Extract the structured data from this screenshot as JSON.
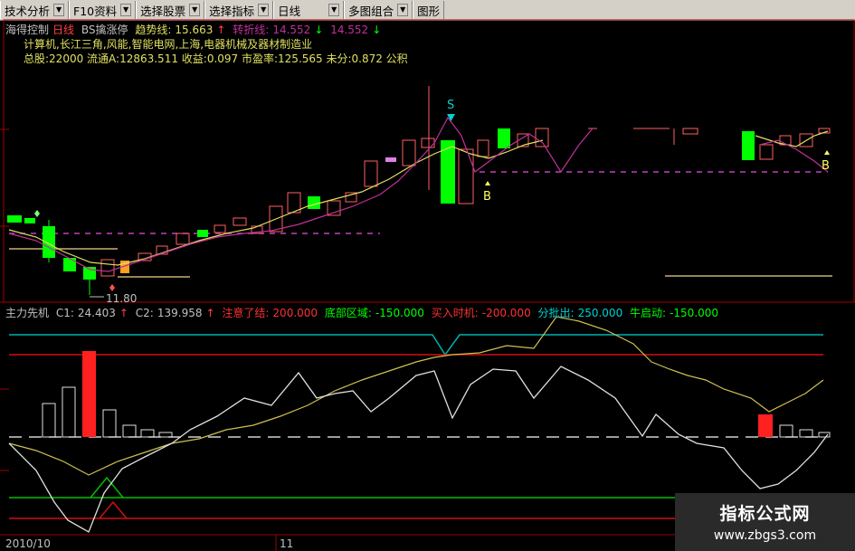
{
  "toolbar": {
    "items": [
      {
        "label": "技术分析"
      },
      {
        "label": "F10资料"
      },
      {
        "label": "选择股票"
      },
      {
        "label": "选择指标"
      },
      {
        "label": "日线"
      },
      {
        "label": "多图组合"
      },
      {
        "label": "图形"
      }
    ]
  },
  "main_header": {
    "stock_name": "海得控制",
    "period": "日线",
    "indicator": "BS擒涨停",
    "trend_label": "趋势线:",
    "trend_value": "15.663",
    "turn_label": "转折线:",
    "turn_value": "14.552",
    "turn_value2": "14.552"
  },
  "stock_info": {
    "line1": "计算机,长江三角,风能,智能电网,上海,电器机械及器材制造业",
    "line2": "总股:22000 流通A:12863.511 收益:0.097 市盈率:125.565 未分:0.872 公积"
  },
  "price_labels": {
    "low": "11.80",
    "sell_marker": "S",
    "buy_marker": "B",
    "buy_marker2": "B"
  },
  "sub_header": {
    "name": "主力先机",
    "c1_label": "C1:",
    "c1_value": "24.403",
    "c2_label": "C2:",
    "c2_value": "139.958",
    "attention_label": "注意了结:",
    "attention_value": "200.000",
    "bottom_label": "底部区域:",
    "bottom_value": "-150.000",
    "buy_label": "买入时机:",
    "buy_value": "-200.000",
    "batch_label": "分批出:",
    "batch_value": "250.000",
    "bull_label": "牛启动:",
    "bull_value": "-150.000"
  },
  "date_axis": {
    "start": "2010/10",
    "mark": "11"
  },
  "watermark": {
    "title": "指标公式网",
    "url": "www.zbgs3.com"
  },
  "colors": {
    "up": "#ff5050",
    "down": "#00ff00",
    "trend": "#e0e060",
    "turn": "#c0309a",
    "cyan": "#00b0b0"
  }
}
